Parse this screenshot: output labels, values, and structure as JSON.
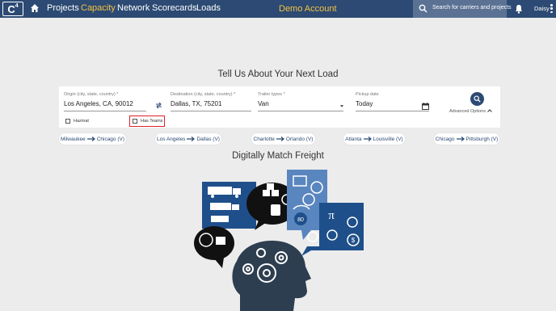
{
  "nav": {
    "logo": "C",
    "logo_sup": "4",
    "links": [
      "Projects",
      "Capacity",
      "Network",
      "Scorecards",
      "Loads"
    ],
    "active": "Capacity",
    "demo_label": "Demo Account",
    "search_placeholder": "Search for carriers and projects",
    "user": "Daisy"
  },
  "form": {
    "heading": "Tell Us About Your Next Load",
    "origin": {
      "label": "Origin (city, state, country) *",
      "value": "Los Angeles, CA, 90012"
    },
    "destination": {
      "label": "Destination (city, state, country) *",
      "value": "Dallas, TX, 75201"
    },
    "trailer": {
      "label": "Trailer types *",
      "value": "Van"
    },
    "pickup": {
      "label": "Pickup date",
      "value": "Today"
    },
    "advanced_label": "Advanced Options",
    "hazmat_label": "Hazmat",
    "has_teams_label": "Has Teams"
  },
  "routes": [
    {
      "from": "Milwaukee",
      "to": "Chicago (V)"
    },
    {
      "from": "Los Angeles",
      "to": "Dallas (V)"
    },
    {
      "from": "Charlotte",
      "to": "Orlando (V)"
    },
    {
      "from": "Atlanta",
      "to": "Louisville (V)"
    },
    {
      "from": "Chicago",
      "to": "Pittsburgh (V)"
    }
  ],
  "subheading": "Digitally Match Freight",
  "illustration": {
    "badge": "80",
    "pi": "π",
    "dollar": "$"
  },
  "colors": {
    "navy": "#2c4a73",
    "accent": "#f5c242",
    "highlight": "#e0202a",
    "bg": "#ececec"
  }
}
